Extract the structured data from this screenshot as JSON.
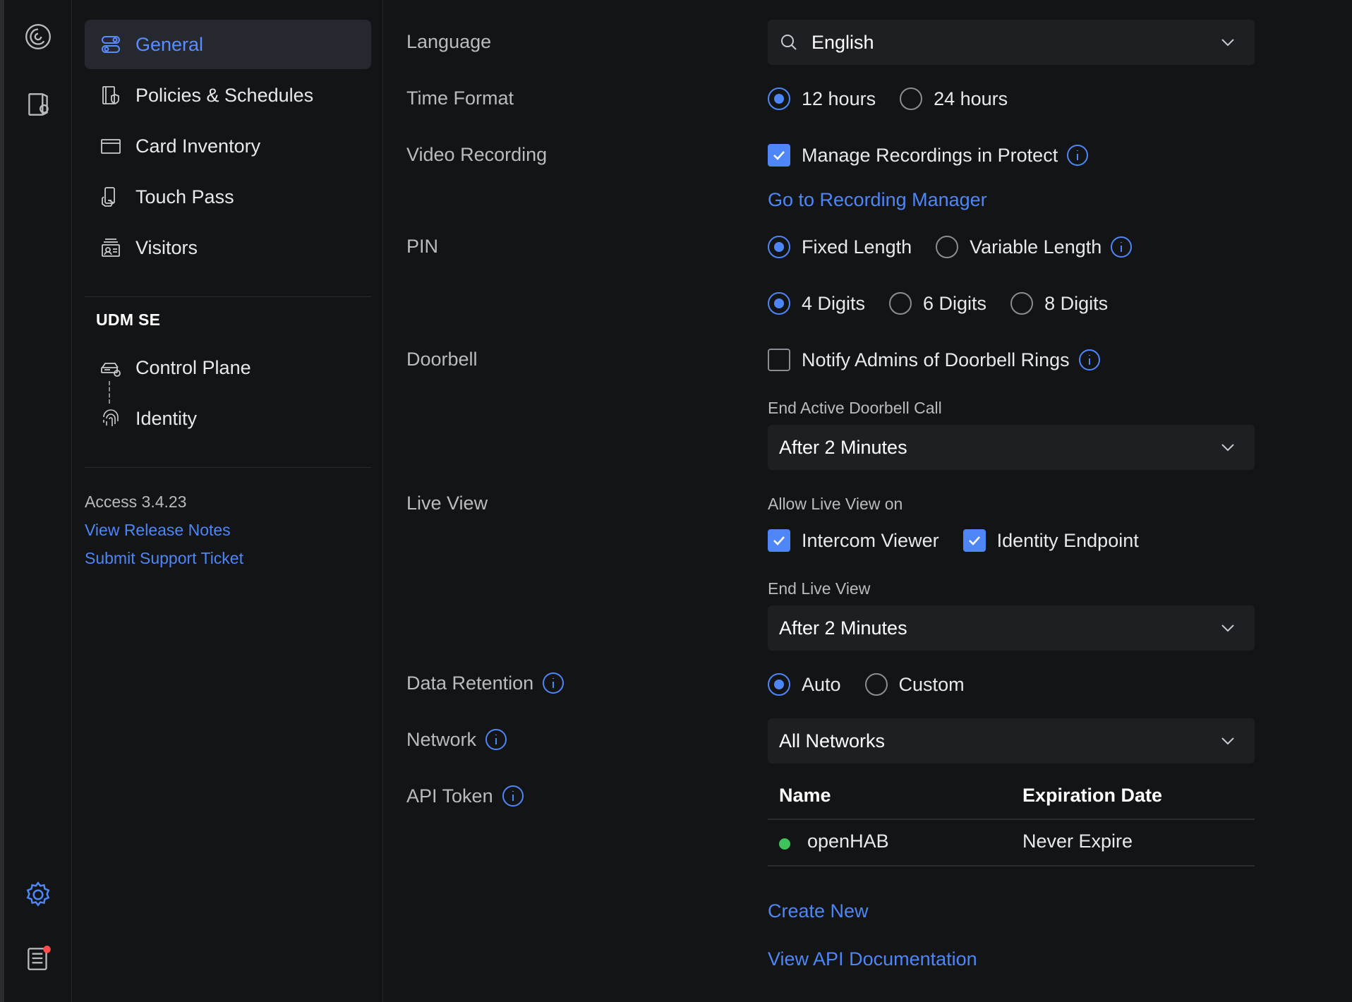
{
  "colors": {
    "accent": "#4f86f7",
    "status_active": "#3ec25c",
    "notification": "#ff4d4d"
  },
  "rail": {
    "icons": [
      "access-logo-icon",
      "door-lock-icon",
      "gear-icon",
      "system-log-icon"
    ]
  },
  "sidebar": {
    "items": [
      {
        "label": "General",
        "icon": "toggle-settings-icon",
        "active": true
      },
      {
        "label": "Policies & Schedules",
        "icon": "policy-shield-icon"
      },
      {
        "label": "Card Inventory",
        "icon": "card-icon"
      },
      {
        "label": "Touch Pass",
        "icon": "touch-pass-icon"
      },
      {
        "label": "Visitors",
        "icon": "visitor-badge-icon"
      }
    ],
    "device_section": "UDM SE",
    "device_items": [
      {
        "label": "Control Plane",
        "icon": "control-plane-icon"
      },
      {
        "label": "Identity",
        "icon": "fingerprint-icon"
      }
    ],
    "version": "Access 3.4.23",
    "release_notes": "View Release Notes",
    "support_ticket": "Submit Support Ticket"
  },
  "settings": {
    "language": {
      "label": "Language",
      "value": "English"
    },
    "time_format": {
      "label": "Time Format",
      "options": [
        "12 hours",
        "24 hours"
      ],
      "selected": "12 hours"
    },
    "video_recording": {
      "label": "Video Recording",
      "checkbox": "Manage Recordings in Protect",
      "checked": true,
      "link": "Go to Recording Manager"
    },
    "pin": {
      "label": "PIN",
      "length_options": [
        "Fixed Length",
        "Variable Length"
      ],
      "length_selected": "Fixed Length",
      "digit_options": [
        "4 Digits",
        "6 Digits",
        "8 Digits"
      ],
      "digit_selected": "4 Digits"
    },
    "doorbell": {
      "label": "Doorbell",
      "checkbox": "Notify Admins of Doorbell Rings",
      "checked": false,
      "end_call_label": "End Active Doorbell Call",
      "end_call_value": "After 2 Minutes"
    },
    "live_view": {
      "label": "Live View",
      "allow_label": "Allow Live View on",
      "options": [
        "Intercom Viewer",
        "Identity Endpoint"
      ],
      "end_label": "End Live View",
      "end_value": "After 2 Minutes"
    },
    "data_retention": {
      "label": "Data Retention",
      "options": [
        "Auto",
        "Custom"
      ],
      "selected": "Auto"
    },
    "network": {
      "label": "Network",
      "value": "All Networks"
    },
    "api_token": {
      "label": "API Token",
      "columns": [
        "Name",
        "Expiration Date"
      ],
      "rows": [
        {
          "name": "openHAB",
          "expiration": "Never Expire",
          "status": "active"
        }
      ],
      "create_new": "Create New",
      "view_docs": "View API Documentation"
    }
  }
}
